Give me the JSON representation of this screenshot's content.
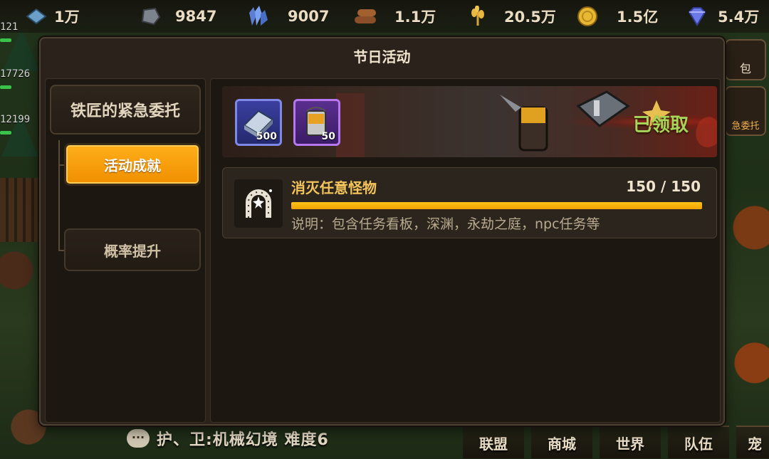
{
  "resources": [
    {
      "icon": "gem-cluster-icon",
      "value": "1万"
    },
    {
      "icon": "stone-icon",
      "value": "9847"
    },
    {
      "icon": "crystal-icon",
      "value": "9007"
    },
    {
      "icon": "wood-icon",
      "value": "1.1万"
    },
    {
      "icon": "wheat-icon",
      "value": "20.5万"
    },
    {
      "icon": "coin-icon",
      "value": "1.5亿"
    },
    {
      "icon": "diamond-icon",
      "value": "5.4万"
    }
  ],
  "side_numbers": [
    "121",
    "17726",
    "12199"
  ],
  "dialog": {
    "title": "节日活动",
    "category": "铁匠的紧急委托",
    "tabs": [
      {
        "label": "活动成就",
        "active": true
      },
      {
        "label": "概率提升",
        "active": false
      }
    ]
  },
  "banner": {
    "rewards": [
      {
        "icon": "iron-ingot-icon",
        "count": "500"
      },
      {
        "icon": "bucket-icon",
        "count": "50"
      }
    ],
    "status": "已领取"
  },
  "task": {
    "icon": "horseshoe-icon",
    "name": "消灭任意怪物",
    "progress_current": 150,
    "progress_total": 150,
    "progress_text": "150 / 150",
    "progress_fraction": 1.0,
    "description": "说明：包含任务看板，深渊，永劫之庭，npc任务等"
  },
  "chat": {
    "message": "护、卫:机械幻境 难度6"
  },
  "bottom_nav": [
    "联盟",
    "商城",
    "世界",
    "队伍",
    "宠"
  ],
  "right_side": [
    "包",
    "急委托"
  ],
  "colors": {
    "accent_orange": "#f5a00a",
    "claimed_green": "#a6d65a",
    "task_title_gold": "#f2c45a",
    "progress_fill": "#ffc21a"
  }
}
